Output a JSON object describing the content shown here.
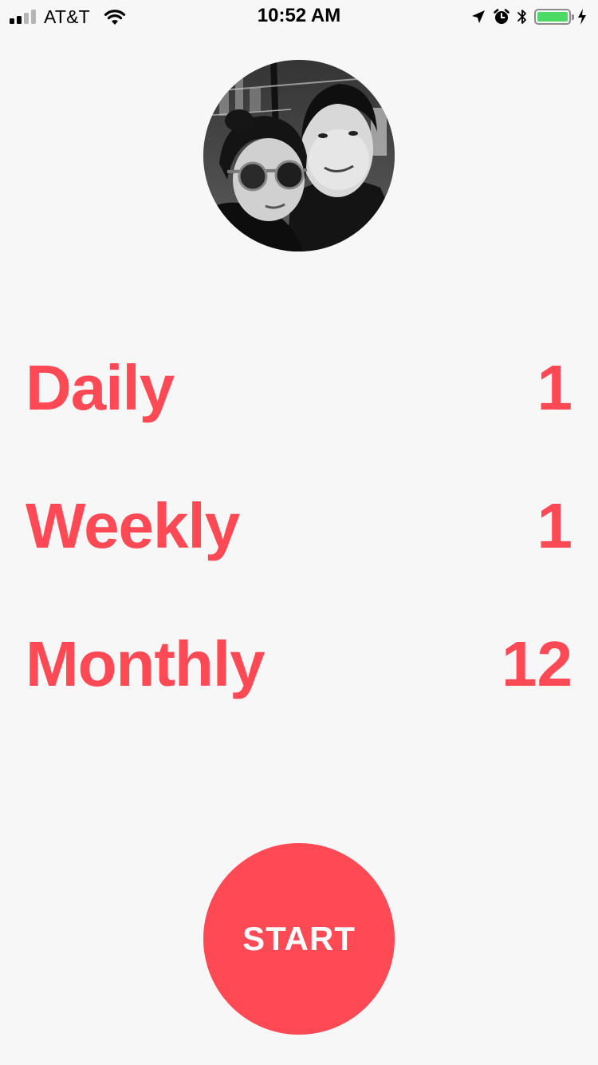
{
  "status_bar": {
    "carrier": "AT&T",
    "time": "10:52 AM",
    "battery_level": 1.0,
    "colors": {
      "battery": "#4cd964"
    }
  },
  "profile": {
    "avatar_icon": "profile-photo"
  },
  "stats": [
    {
      "label": "Daily",
      "value": "1"
    },
    {
      "label": "Weekly",
      "value": "1"
    },
    {
      "label": "Monthly",
      "value": "12"
    }
  ],
  "start_button": {
    "label": "START"
  },
  "colors": {
    "accent": "#ff4a56",
    "background": "#f7f7f7"
  }
}
